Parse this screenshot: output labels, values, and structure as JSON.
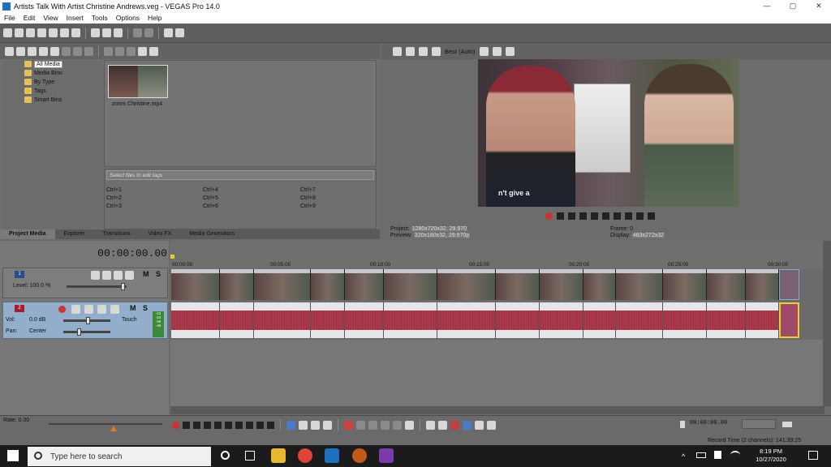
{
  "window": {
    "title": "Artists Talk With Artist Christine Andrews.veg - VEGAS Pro 14.0",
    "min": "—",
    "max": "▢",
    "close": "✕"
  },
  "menu": [
    "File",
    "Edit",
    "View",
    "Insert",
    "Tools",
    "Options",
    "Help"
  ],
  "media_tree": [
    "All Media",
    "Media Bins",
    "By Type",
    "Tags",
    "Smart Bins"
  ],
  "media_file": "zoom Christine.mp4",
  "tag_placeholder": "Select files to edit tags",
  "tag_shortcuts": [
    "Ctrl+1",
    "Ctrl+4",
    "Ctrl+7",
    "Ctrl+2",
    "Ctrl+5",
    "Ctrl+8",
    "Ctrl+3",
    "Ctrl+6",
    "Ctrl+9"
  ],
  "left_tabs": [
    "Project Media",
    "Explorer",
    "Transitions",
    "Video FX",
    "Media Generators"
  ],
  "preview": {
    "quality": "Best (Auto)",
    "shirt_text": "n't give a",
    "project_label": "Project:",
    "project_value": "1280x720x32, 29.970",
    "preview_label": "Preview:",
    "preview_value": "320x180x32, 29.970p",
    "frame_label": "Frame:",
    "frame_value": "0",
    "display_label": "Display:",
    "display_value": "483x272x32"
  },
  "timeline": {
    "timecode": "00:00:00.00",
    "ruler": [
      "00:00:00",
      "00:05:00",
      "00:10:00",
      "00:15:00",
      "00:20:00",
      "00:25:00",
      "00:30:00"
    ]
  },
  "track1": {
    "num": "1",
    "level_label": "Level: 100.0 %",
    "m": "M",
    "s": "S"
  },
  "track2": {
    "num": "2",
    "vol_label": "Vol:",
    "vol_value": "0.0 dB",
    "pan_label": "Pan:",
    "pan_value": "Center",
    "touch": "Touch",
    "m": "M",
    "s": "S"
  },
  "meters": [
    "-12",
    "-24",
    "-36",
    "-48",
    "-60",
    "-72"
  ],
  "bottom": {
    "rate": "Rate: 0.00",
    "tc": "00:00:00.00",
    "record_time": "Record Time (2 channels): 141:39:25"
  },
  "taskbar": {
    "search_placeholder": "Type here to search",
    "time": "8:19 PM",
    "date": "10/27/2020"
  }
}
